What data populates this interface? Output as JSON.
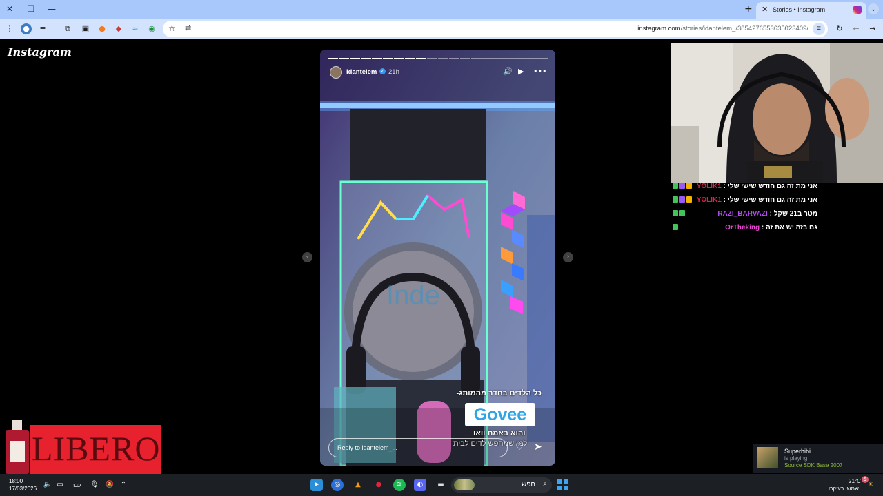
{
  "browser": {
    "tab_title": "Stories • Instagram",
    "tab_close": "✕",
    "new_tab": "+",
    "url_host": "instagram.com",
    "url_path": "/stories/idantelem_/3854276553635023409/",
    "window_close": "✕",
    "window_restore": "❐",
    "window_minimize": "—"
  },
  "instagram": {
    "logo": "Instagram"
  },
  "story": {
    "username": "idantelem_",
    "time": "21h",
    "caption_top": "כל הלדים בחדר מהמותג-",
    "brand": "Govee",
    "caption_mid": "והוא באמת וואו",
    "caption_bottom": "למי שמחפש לדים לבית",
    "reply_placeholder": "Reply to idantelem_...",
    "led_sign_text": "Inde",
    "progress_total": 20,
    "progress_done": 9
  },
  "chat": [
    {
      "user": "YOLIK1",
      "message": "אני מת זה גם חודש שישי שלי",
      "color": "#e0204a",
      "badges": [
        "#41c45a",
        "#9b59f6",
        "#f5b400"
      ]
    },
    {
      "user": "YOLIK1",
      "message": "אני מת זה גם חודש שישי שלי",
      "color": "#e0204a",
      "badges": [
        "#41c45a",
        "#9b59f6",
        "#f5b400"
      ]
    },
    {
      "user": "RAZI_BARVAZI",
      "message": "מטר ב21 שקל",
      "color": "#b34df2",
      "badges": [
        "#41c45a",
        "#41c45a"
      ]
    },
    {
      "user": "OrTheking",
      "message": "גם בזה יש את זה",
      "color": "#e64ad1",
      "badges": [
        "#41c45a"
      ]
    }
  ],
  "ad": {
    "brand": "LIBERO"
  },
  "steam": {
    "name": "Superbibi",
    "status": "is playing",
    "game": "Source SDK Base 2007"
  },
  "taskbar": {
    "time": "18:00",
    "date": "17/03/2026",
    "lang": "עבר",
    "search_placeholder": "חפש",
    "temp": "21°C",
    "weather": "שמשי בעיקרו",
    "notif_count": "5"
  }
}
